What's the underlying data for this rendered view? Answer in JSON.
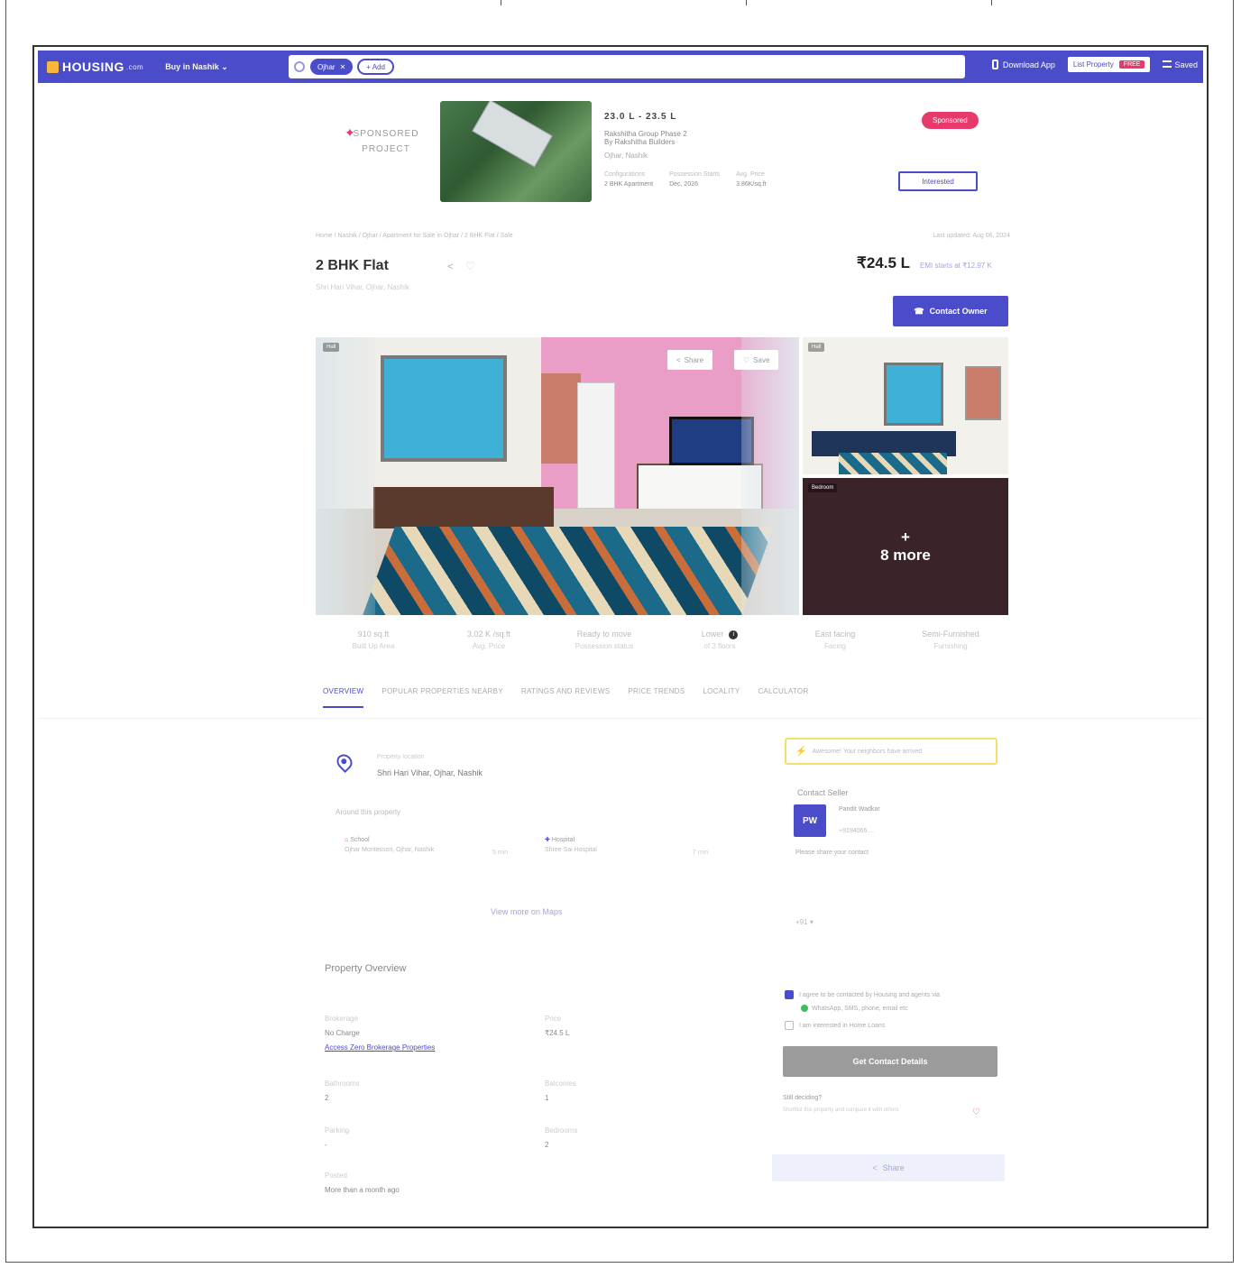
{
  "header": {
    "logo_text": "HOUSING",
    "logo_tld": ".com",
    "buy_in": "Buy in Nashik",
    "chips": [
      "Ojhar",
      "+ Add"
    ],
    "download_app": "Download App",
    "list_property": "List Property",
    "free_badge": "FREE",
    "menu_label": "Saved"
  },
  "sponsored": {
    "badge": "SPONSORED PROJECT",
    "price_range": "23.0 L - 23.5 L",
    "project_name": "Rakshitha Group Phase 2",
    "developer": "By Rakshitha Builders",
    "location": "Ojhar, Nashik",
    "cols": [
      {
        "label": "Configurations",
        "value": "2 BHK Apartment"
      },
      {
        "label": "Possession Starts",
        "value": "Dec, 2026"
      },
      {
        "label": "Avg. Price",
        "value": "3.86K/sq.ft"
      }
    ],
    "pill": "Sponsored",
    "interested_btn": "Interested"
  },
  "listing": {
    "breadcrumb": "Home / Nashik / Ojhar / Apartment for Sale in Ojhar / 2 BHK Flat / Sale",
    "last_updated": "Last updated: Aug 06, 2024",
    "title": "2 BHK Flat",
    "sublocation": "Shri Hari Vihar, Ojhar, Nashik",
    "price": "₹24.5 L",
    "emi": "EMI starts at ₹12.97 K",
    "contact_owner": "Contact Owner"
  },
  "gallery": {
    "tag_main": "Hall",
    "tag_side1": "Hall",
    "tag_side2": "Bedroom",
    "share_btn": "Share",
    "save_btn": "Save",
    "more_plus": "+",
    "more_label": "8 more"
  },
  "stats": [
    {
      "value": "910 sq.ft",
      "label": "Built Up Area"
    },
    {
      "value": "3.02 K /sq.ft",
      "label": "Avg. Price"
    },
    {
      "value": "Ready to move",
      "label": "Possession status"
    },
    {
      "value": "Lower",
      "label": "of 3 floors"
    },
    {
      "value": "East facing",
      "label": "Facing"
    },
    {
      "value": "Semi-Furnished",
      "label": "Furnishing"
    }
  ],
  "tabs": [
    "OVERVIEW",
    "POPULAR PROPERTIES NEARBY",
    "RATINGS AND REVIEWS",
    "PRICE TRENDS",
    "LOCALITY",
    "CALCULATOR"
  ],
  "location": {
    "label": "Property location",
    "value": "Shri Hari Vihar, Ojhar, Nashik",
    "around": "Around this property",
    "nearby": [
      {
        "category": "School",
        "name": "Ojhar Montessori, Ojhar, Nashik",
        "time": "5 min"
      },
      {
        "category": "Hospital",
        "name": "Shree Sai Hospital",
        "time": "7 min"
      }
    ],
    "view_maps": "View more on Maps"
  },
  "overview": {
    "title": "Property Overview",
    "items": [
      {
        "key": "Brokerage",
        "value": "No Charge",
        "link": "Access Zero Brokerage Properties"
      },
      {
        "key": "Price",
        "value": "₹24.5 L"
      },
      {
        "key": "Bathrooms",
        "value": "2"
      },
      {
        "key": "Balconies",
        "value": "1"
      },
      {
        "key": "Parking",
        "value": "-"
      },
      {
        "key": "Bedrooms",
        "value": "2"
      },
      {
        "key": "Posted",
        "value": "More than a month ago"
      }
    ]
  },
  "seller": {
    "alert": "Awesome! Your neighbors have arrived",
    "title": "Contact Seller",
    "avatar": "PW",
    "name": "Pandit Wadkar",
    "phone": "+9194066....",
    "share_contact": "Please share your contact",
    "country_code": "+91",
    "agree": "I agree to be contacted by Housing and agents via",
    "whatsapp": "WhatsApp, SMS, phone, email etc",
    "home_loan": "I am interested in Home Loans",
    "get_contact": "Get Contact Details",
    "still_deciding": "Still deciding?",
    "shortlist": "Shortlist this property and compare it with others",
    "share": "Share"
  }
}
